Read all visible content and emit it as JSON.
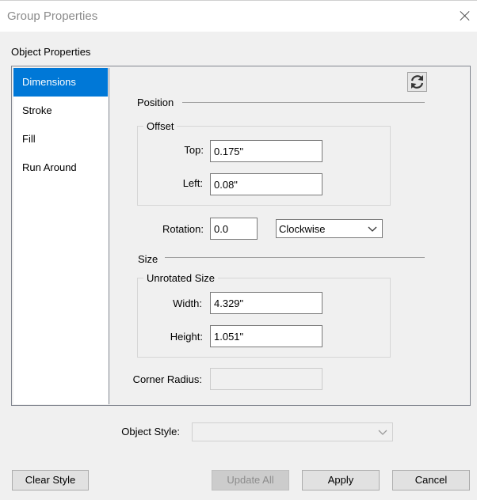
{
  "window": {
    "title": "Group Properties"
  },
  "object_properties": {
    "label": "Object Properties"
  },
  "sidebar": {
    "items": [
      {
        "label": "Dimensions",
        "selected": true
      },
      {
        "label": "Stroke",
        "selected": false
      },
      {
        "label": "Fill",
        "selected": false
      },
      {
        "label": "Run Around",
        "selected": false
      }
    ]
  },
  "position": {
    "label": "Position",
    "offset": {
      "label": "Offset",
      "top_label": "Top:",
      "top_value": "0.175\"",
      "left_label": "Left:",
      "left_value": "0.08\""
    },
    "rotation_label": "Rotation:",
    "rotation_value": "0.0",
    "direction_value": "Clockwise"
  },
  "size": {
    "label": "Size",
    "unrotated": {
      "label": "Unrotated Size",
      "width_label": "Width:",
      "width_value": "4.329\"",
      "height_label": "Height:",
      "height_value": "1.051\""
    },
    "corner_radius_label": "Corner Radius:",
    "corner_radius_value": ""
  },
  "object_style": {
    "label": "Object Style:",
    "value": ""
  },
  "buttons": {
    "clear_style": "Clear Style",
    "update_all": "Update All",
    "apply": "Apply",
    "cancel": "Cancel"
  },
  "colors": {
    "selection": "#0078d7",
    "dialog_bg": "#f0f0f0"
  },
  "icons": {
    "refresh": "refresh-icon",
    "close": "close-icon",
    "dropdown": "chevron-down-icon"
  }
}
